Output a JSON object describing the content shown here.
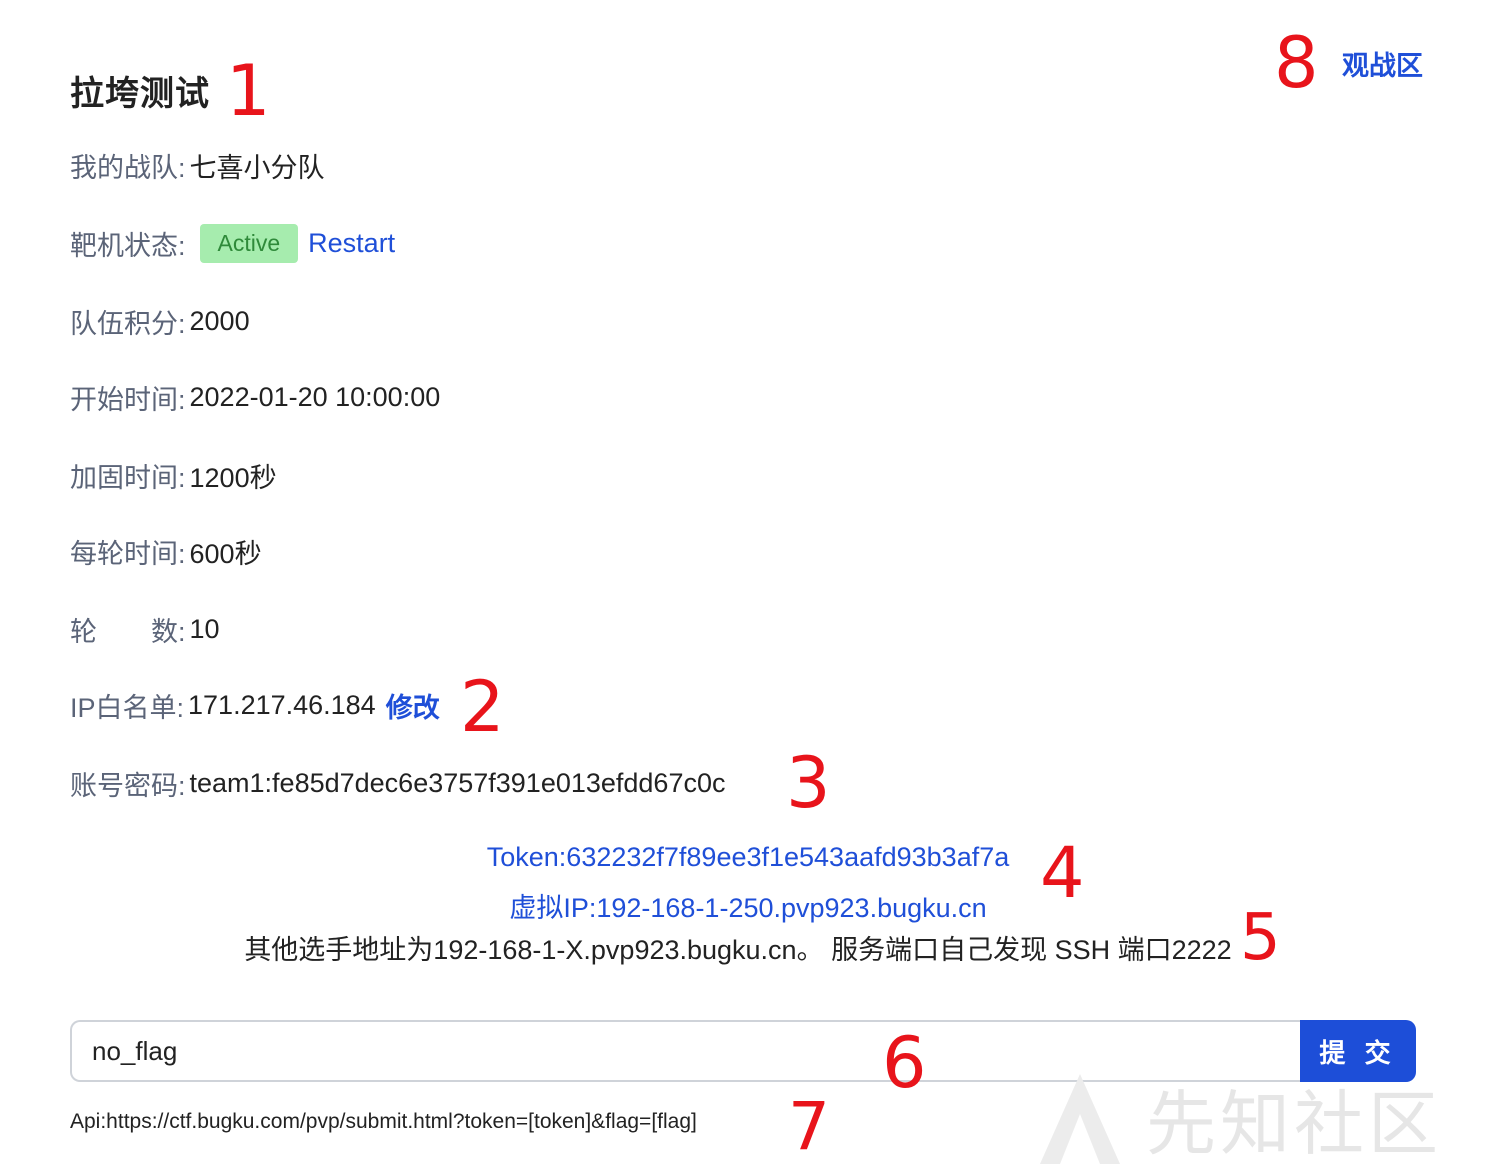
{
  "page": {
    "title": "拉垮测试",
    "spectate_link": "观战区"
  },
  "info": {
    "team": {
      "label": "我的战队:",
      "value": "七喜小分队"
    },
    "status": {
      "label": "靶机状态:",
      "badge": "Active",
      "action": "Restart"
    },
    "score": {
      "label": "队伍积分:",
      "value": "2000"
    },
    "start_time": {
      "label": "开始时间:",
      "value": "2022-01-20 10:00:00"
    },
    "harden_time": {
      "label": "加固时间:",
      "value": "1200秒"
    },
    "round_time": {
      "label": "每轮时间:",
      "value": "600秒"
    },
    "rounds": {
      "label_a": "轮",
      "label_b": "数:",
      "value": "10"
    },
    "whitelist": {
      "label": "IP白名单:",
      "value": "171.217.46.184",
      "action": "修改"
    },
    "account": {
      "label": "账号密码:",
      "value": "team1:fe85d7dec6e3757f391e013efdd67c0c"
    }
  },
  "access": {
    "token": "Token:632232f7f89ee3f1e543aafd93b3af7a",
    "virtual_ip": "虚拟IP:192-168-1-250.pvp923.bugku.cn",
    "note": "其他选手地址为192-168-1-X.pvp923.bugku.cn。 服务端口自己发现 SSH 端口2222"
  },
  "submit": {
    "input_value": "no_flag",
    "button_label": "提 交",
    "api": "Api:https://ctf.bugku.com/pvp/submit.html?token=[token]&flag=[flag]"
  },
  "annotations": [
    "1",
    "2",
    "3",
    "4",
    "5",
    "6",
    "7",
    "8"
  ],
  "watermark": "先知社区",
  "colors": {
    "accent_blue": "#1f4fd8",
    "button_blue": "#1d4ed8",
    "active_badge_bg": "#a6ecae",
    "active_badge_text": "#2f8a3a",
    "annotation_red": "#e8141b",
    "label_gray": "#5b6478"
  }
}
